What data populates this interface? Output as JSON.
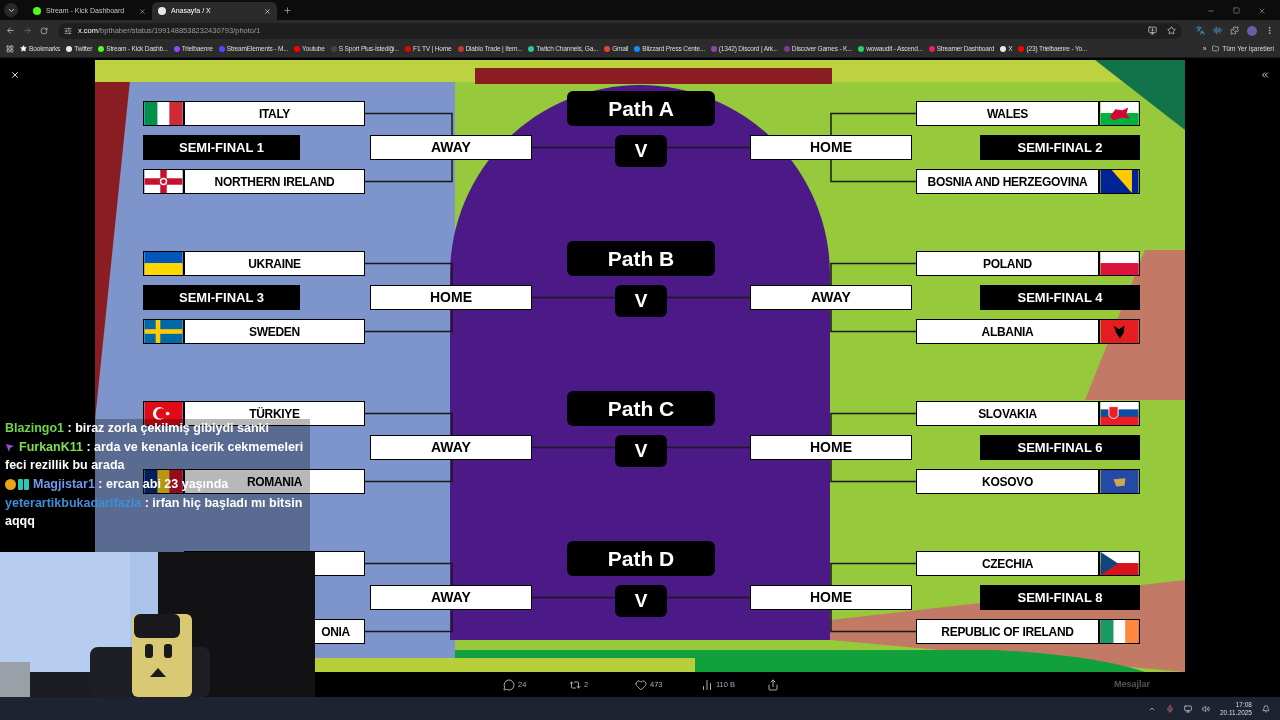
{
  "tabs": [
    {
      "label": "Stream - Kick Dashboard",
      "selected": false,
      "color": "#53fc18"
    },
    {
      "label": "Anasayfa / X",
      "selected": true,
      "color": "#e7e9ea"
    }
  ],
  "address": {
    "host": "x.com",
    "path": "/bpthaber/status/1991488538232430793/photo/1"
  },
  "bookmarks": [
    {
      "label": "Bookmarks",
      "kind": "star"
    },
    {
      "label": "Twitter",
      "kind": "site",
      "color": "#e7e9ea"
    },
    {
      "label": "Stream - Kick Dashb...",
      "kind": "site",
      "color": "#53fc18"
    },
    {
      "label": "Trielbaenre",
      "kind": "site",
      "color": "#9146ff"
    },
    {
      "label": "StreamElements - M...",
      "kind": "site",
      "color": "#4e4bff"
    },
    {
      "label": "Youtube",
      "kind": "site",
      "color": "#ff0000"
    },
    {
      "label": "S Sport Plus-İstediği...",
      "kind": "site",
      "color": "#444444"
    },
    {
      "label": "F1 TV | Home",
      "kind": "site",
      "color": "#e10600"
    },
    {
      "label": "Diablo Trade | Item...",
      "kind": "site",
      "color": "#c0392b"
    },
    {
      "label": "Twitch Channels, Ga...",
      "kind": "site",
      "color": "#2ec4a5"
    },
    {
      "label": "Gmail",
      "kind": "site",
      "color": "#ea4335"
    },
    {
      "label": "Blizzard Press Cente...",
      "kind": "site",
      "color": "#148eff"
    },
    {
      "label": "(1342) Discord | Ark...",
      "kind": "site",
      "color": "#8e44ad"
    },
    {
      "label": "Discover Games - K...",
      "kind": "site",
      "color": "#7a3b8f"
    },
    {
      "label": "wowaudit - Ascend...",
      "kind": "site",
      "color": "#25d366"
    },
    {
      "label": "Streamer Dashboard",
      "kind": "site",
      "color": "#e91e63"
    },
    {
      "label": "X",
      "kind": "site",
      "color": "#e7e9ea"
    },
    {
      "label": "(23) Trielbaenre - Yo...",
      "kind": "site",
      "color": "#ff0000"
    }
  ],
  "bookmarks_more": "»",
  "all_bookmarks": "Tüm Yer İşaretleri",
  "paths": [
    {
      "label": "Path A",
      "vs": "V",
      "left": {
        "team1": {
          "name": "ITALY",
          "kind": "italy"
        },
        "semifinal": "SEMI-FINAL 1",
        "team2": {
          "name": "NORTHERN IRELAND",
          "kind": "northern_ireland"
        },
        "venue": "AWAY"
      },
      "right": {
        "team1": {
          "name": "WALES",
          "kind": "wales"
        },
        "semifinal": "SEMI-FINAL 2",
        "team2": {
          "name": "BOSNIA AND HERZEGOVINA",
          "kind": "bosnia"
        },
        "venue": "HOME"
      }
    },
    {
      "label": "Path B",
      "vs": "V",
      "left": {
        "team1": {
          "name": "UKRAINE",
          "kind": "ukraine"
        },
        "semifinal": "SEMI-FINAL 3",
        "team2": {
          "name": "SWEDEN",
          "kind": "sweden"
        },
        "venue": "HOME"
      },
      "right": {
        "team1": {
          "name": "POLAND",
          "kind": "poland"
        },
        "semifinal": "SEMI-FINAL 4",
        "team2": {
          "name": "ALBANIA",
          "kind": "albania"
        },
        "venue": "AWAY"
      }
    },
    {
      "label": "Path C",
      "vs": "V",
      "left": {
        "team1": {
          "name": "TÜRKIYE",
          "kind": "turkiye"
        },
        "team2": {
          "name": "ROMANIA",
          "kind": "romania"
        },
        "venue": "AWAY"
      },
      "right": {
        "team1": {
          "name": "SLOVAKIA",
          "kind": "slovakia"
        },
        "semifinal": "SEMI-FINAL 6",
        "team2": {
          "name": "KOSOVO",
          "kind": "kosovo"
        },
        "venue": "HOME"
      }
    },
    {
      "label": "Path D",
      "vs": "V",
      "left": {
        "team2": {
          "name": "ONIA",
          "cut": true
        },
        "venue": "AWAY"
      },
      "right": {
        "team1": {
          "name": "CZECHIA",
          "kind": "czechia"
        },
        "semifinal": "SEMI-FINAL 8",
        "team2": {
          "name": "REPUBLIC OF IRELAND",
          "kind": "ireland"
        },
        "venue": "HOME"
      }
    }
  ],
  "chat": [
    {
      "user": "Blazingo1",
      "color": "#6fd44a",
      "text": ": biraz zorla çekilmiş gibiydi sanki"
    },
    {
      "user": "FurkanK11",
      "color": "#7ee04a",
      "text": ": arda ve kenanla icerik cekmemeleri feci rezillik bu arada",
      "badges": [
        {
          "kind": "sub"
        }
      ]
    },
    {
      "user": "Magjistar1",
      "color": "#6f9ae8",
      "text": ": ercan abi 23 yaşında",
      "badges": [
        {
          "kind": "one"
        },
        {
          "kind": "gift"
        }
      ]
    },
    {
      "user": "yeterartikbukadarifazla",
      "color": "#3c8fd8",
      "text": ": irfan hiç başladı mı bitsin aqqq"
    }
  ],
  "actions": [
    {
      "kind": "reply",
      "count": "24"
    },
    {
      "kind": "repost",
      "count": "2"
    },
    {
      "kind": "like",
      "count": "473"
    },
    {
      "kind": "views",
      "count": "110 B"
    },
    {
      "kind": "share"
    }
  ],
  "messages_label": "Mesajlar",
  "clock": {
    "time": "17:08",
    "date": "20.11.2025"
  }
}
